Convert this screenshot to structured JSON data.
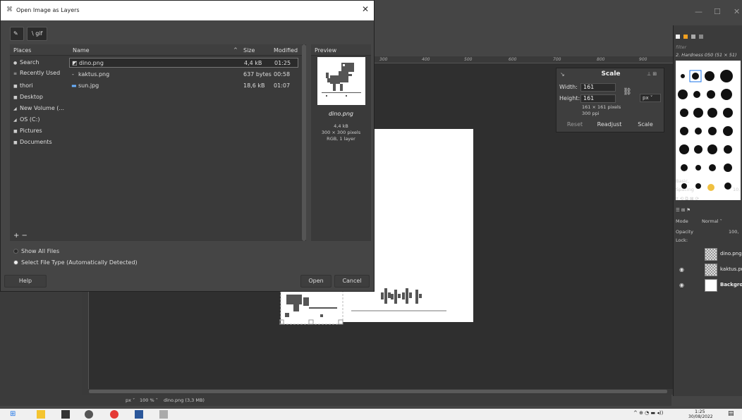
{
  "open_dialog": {
    "title": "Open Image as Layers",
    "path_buttons": [
      "gif"
    ],
    "places_header": "Places",
    "places": [
      {
        "label": "Search",
        "icon": "search-icon"
      },
      {
        "label": "Recently Used",
        "icon": "recent-icon"
      },
      {
        "label": "thori",
        "icon": "folder-icon"
      },
      {
        "label": "Desktop",
        "icon": "folder-icon"
      },
      {
        "label": "New Volume (...",
        "icon": "drive-icon"
      },
      {
        "label": "OS (C:)",
        "icon": "drive-icon"
      },
      {
        "label": "Pictures",
        "icon": "folder-icon"
      },
      {
        "label": "Documents",
        "icon": "folder-icon"
      }
    ],
    "places_add_remove": "+ −",
    "columns": {
      "name": "Name",
      "size": "Size",
      "modified": "Modified"
    },
    "files": [
      {
        "name": "dino.png",
        "size": "4,4 kB",
        "modified": "01:25",
        "selected": true
      },
      {
        "name": "kaktus.png",
        "size": "637 bytes",
        "modified": "00:58",
        "selected": false
      },
      {
        "name": "sun.jpg",
        "size": "18,6 kB",
        "modified": "01:07",
        "selected": false
      }
    ],
    "preview": {
      "header": "Preview",
      "filename": "dino.png",
      "size": "4,4 kB",
      "dimensions": "300 × 300 pixels",
      "type": "RGB, 1 layer"
    },
    "show_all_files": "Show All Files",
    "select_file_type": "Select File Type (Automatically Detected)",
    "help_label": "Help",
    "open_label": "Open",
    "cancel_label": "Cancel"
  },
  "scale_dialog": {
    "title": "Scale",
    "width_label": "Width:",
    "width_value": "161",
    "height_label": "Height:",
    "height_value": "161",
    "unit": "px",
    "info_pixels": "161 × 161 pixels",
    "info_ppi": "300 ppi",
    "reset_label": "Reset",
    "readjust_label": "Readjust",
    "scale_label": "Scale"
  },
  "right_panel": {
    "brush_name": "2. Hardness 050 (51 × 51)",
    "filter_placeholder": "filter",
    "basic_label": "Basic,",
    "spacing_label": "Spacing",
    "spacing_value": "10,",
    "mode_label": "Mode",
    "mode_value": "Normal",
    "opacity_label": "Opacity",
    "opacity_value": "100,",
    "lock_label": "Lock:",
    "layers": [
      {
        "name": "dino.png"
      },
      {
        "name": "kaktus.pn"
      },
      {
        "name": "Backgro"
      }
    ]
  },
  "status": {
    "unit": "px",
    "zoom": "100 %",
    "file_info": "dino.png (3,3 MB)"
  },
  "rulers": [
    "300",
    "400",
    "500",
    "600",
    "700",
    "800",
    "900"
  ],
  "taskbar": {
    "time": "1:25",
    "date": "30/08/2022"
  },
  "colors": {
    "accent": "#1a73e8",
    "canvas": "#ffffff",
    "dark_bg": "#454545"
  }
}
